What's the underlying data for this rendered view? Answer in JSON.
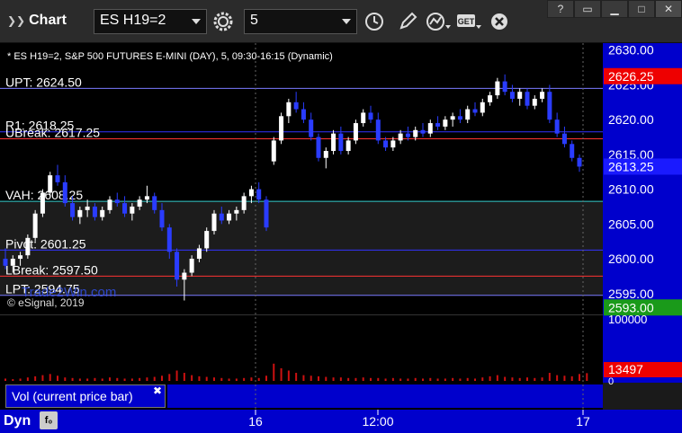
{
  "window": {
    "title": "Chart"
  },
  "toolbar": {
    "symbol": "ES H19=2",
    "interval": "5",
    "tool_icons": [
      "gear-icon",
      "clock-icon",
      "pencil-icon",
      "study-icon",
      "get-icon",
      "close-icon"
    ]
  },
  "chart": {
    "header": "* ES H19=2, S&P 500 FUTURES E-MINI (DAY), 5, 09:30-16:15 (Dynamic)",
    "copyright": "© eSignal, 2019",
    "price_axis_ticks": [
      "2630.00",
      "2625.00",
      "2620.00",
      "2615.00",
      "2610.00",
      "2605.00",
      "2600.00",
      "2595.00"
    ],
    "badges": {
      "upper": "2626.25",
      "last": "2613.25",
      "lower": "2593.00"
    },
    "levels": [
      {
        "label": "UPT: 2624.50",
        "price": 2624.5,
        "color": "#7a7aff"
      },
      {
        "label": "R1: 2618.25",
        "price": 2618.25,
        "color": "#3333ff"
      },
      {
        "label": "UBreak: 2617.25",
        "price": 2617.25,
        "color": "#ff3333"
      },
      {
        "label": "VAH: 2608.25",
        "price": 2608.25,
        "color": "#33cccc"
      },
      {
        "label": "Pivot: 2601.25",
        "price": 2601.25,
        "color": "#3333ff"
      },
      {
        "label": "LBreak: 2597.50",
        "price": 2597.5,
        "color": "#ff3333"
      },
      {
        "label": "LPT: 2594.75",
        "price": 2594.75,
        "color": "#7a7aff"
      }
    ],
    "watermark": "Trade2Win.com"
  },
  "volume": {
    "legend": "Vol (current price bar)",
    "axis_ticks": [
      "100000",
      "0"
    ],
    "badge": "13497"
  },
  "time_axis": {
    "label": "Dyn",
    "ticks": [
      "16",
      "12:00",
      "17"
    ]
  },
  "chart_data": {
    "type": "candlestick",
    "ylim": [
      2592,
      2631
    ],
    "bars": [
      [
        2600.0,
        2601.5,
        2598.5,
        2599.0
      ],
      [
        2599.0,
        2600.5,
        2598.0,
        2600.0
      ],
      [
        2600.0,
        2601.0,
        2599.0,
        2600.5
      ],
      [
        2600.5,
        2603.5,
        2600.0,
        2603.0
      ],
      [
        2603.0,
        2607.0,
        2602.5,
        2606.5
      ],
      [
        2606.5,
        2610.0,
        2606.0,
        2609.5
      ],
      [
        2609.5,
        2612.5,
        2609.0,
        2612.0
      ],
      [
        2612.0,
        2613.5,
        2610.5,
        2611.0
      ],
      [
        2611.0,
        2612.0,
        2607.5,
        2608.0
      ],
      [
        2608.0,
        2609.0,
        2605.5,
        2606.0
      ],
      [
        2606.0,
        2607.5,
        2605.0,
        2607.0
      ],
      [
        2607.0,
        2608.5,
        2606.0,
        2607.5
      ],
      [
        2607.5,
        2608.0,
        2605.5,
        2606.0
      ],
      [
        2606.0,
        2607.5,
        2605.5,
        2607.0
      ],
      [
        2607.0,
        2609.0,
        2606.5,
        2608.5
      ],
      [
        2608.5,
        2609.5,
        2607.5,
        2608.0
      ],
      [
        2608.0,
        2609.0,
        2606.0,
        2606.5
      ],
      [
        2606.5,
        2608.0,
        2605.5,
        2607.5
      ],
      [
        2607.5,
        2609.0,
        2607.0,
        2608.5
      ],
      [
        2608.5,
        2610.5,
        2608.0,
        2609.0
      ],
      [
        2609.0,
        2609.5,
        2606.5,
        2607.0
      ],
      [
        2607.0,
        2608.0,
        2604.0,
        2604.5
      ],
      [
        2604.5,
        2605.0,
        2600.0,
        2601.0
      ],
      [
        2601.0,
        2601.5,
        2596.0,
        2597.0
      ],
      [
        2597.0,
        2598.5,
        2594.0,
        2598.0
      ],
      [
        2598.0,
        2600.5,
        2597.5,
        2600.0
      ],
      [
        2600.0,
        2602.0,
        2599.5,
        2601.5
      ],
      [
        2601.5,
        2604.5,
        2601.0,
        2604.0
      ],
      [
        2604.0,
        2607.0,
        2603.5,
        2606.5
      ],
      [
        2606.5,
        2607.5,
        2605.0,
        2605.5
      ],
      [
        2605.5,
        2607.0,
        2605.0,
        2606.5
      ],
      [
        2606.5,
        2607.5,
        2605.5,
        2607.0
      ],
      [
        2607.0,
        2609.5,
        2606.5,
        2609.0
      ],
      [
        2609.0,
        2610.5,
        2608.0,
        2610.0
      ],
      [
        2610.0,
        2611.0,
        2608.0,
        2608.5
      ],
      [
        2608.5,
        2609.0,
        2604.0,
        2604.5
      ],
      [
        2614.0,
        2617.5,
        2613.5,
        2617.0
      ],
      [
        2617.0,
        2621.0,
        2616.5,
        2620.5
      ],
      [
        2620.5,
        2623.0,
        2619.5,
        2622.5
      ],
      [
        2622.5,
        2624.0,
        2621.0,
        2621.5
      ],
      [
        2621.5,
        2622.5,
        2619.5,
        2620.0
      ],
      [
        2620.0,
        2621.0,
        2617.0,
        2617.5
      ],
      [
        2617.5,
        2618.0,
        2614.0,
        2614.5
      ],
      [
        2614.5,
        2616.0,
        2613.0,
        2615.5
      ],
      [
        2615.5,
        2618.5,
        2615.0,
        2618.0
      ],
      [
        2618.0,
        2619.0,
        2615.0,
        2615.5
      ],
      [
        2615.5,
        2617.5,
        2615.0,
        2617.0
      ],
      [
        2617.0,
        2620.0,
        2616.5,
        2619.5
      ],
      [
        2619.5,
        2621.5,
        2619.0,
        2621.0
      ],
      [
        2621.0,
        2622.0,
        2619.5,
        2620.0
      ],
      [
        2620.0,
        2621.0,
        2616.5,
        2617.0
      ],
      [
        2617.0,
        2617.5,
        2615.5,
        2616.0
      ],
      [
        2616.0,
        2617.5,
        2615.5,
        2617.0
      ],
      [
        2617.0,
        2618.5,
        2616.5,
        2618.0
      ],
      [
        2618.0,
        2619.0,
        2617.0,
        2617.5
      ],
      [
        2617.5,
        2619.0,
        2617.0,
        2618.5
      ],
      [
        2618.5,
        2619.5,
        2617.5,
        2618.0
      ],
      [
        2618.0,
        2620.0,
        2617.5,
        2619.5
      ],
      [
        2619.5,
        2620.5,
        2618.5,
        2619.0
      ],
      [
        2619.0,
        2620.5,
        2618.5,
        2620.0
      ],
      [
        2620.0,
        2621.0,
        2619.0,
        2620.5
      ],
      [
        2620.5,
        2621.5,
        2619.5,
        2620.0
      ],
      [
        2620.0,
        2622.0,
        2619.5,
        2621.5
      ],
      [
        2621.5,
        2622.5,
        2620.5,
        2621.0
      ],
      [
        2621.0,
        2623.0,
        2620.5,
        2622.5
      ],
      [
        2622.5,
        2624.0,
        2622.0,
        2623.5
      ],
      [
        2623.5,
        2626.0,
        2623.0,
        2625.5
      ],
      [
        2625.5,
        2626.5,
        2623.5,
        2624.0
      ],
      [
        2624.0,
        2625.0,
        2622.5,
        2623.0
      ],
      [
        2623.0,
        2624.5,
        2622.0,
        2624.0
      ],
      [
        2624.0,
        2624.5,
        2621.5,
        2622.0
      ],
      [
        2622.0,
        2623.5,
        2621.5,
        2623.0
      ],
      [
        2623.0,
        2624.5,
        2622.5,
        2624.0
      ],
      [
        2624.0,
        2625.0,
        2619.5,
        2620.0
      ],
      [
        2620.0,
        2621.0,
        2617.5,
        2618.0
      ],
      [
        2618.0,
        2619.0,
        2616.0,
        2616.5
      ],
      [
        2616.5,
        2617.0,
        2614.0,
        2614.5
      ],
      [
        2614.5,
        2615.0,
        2612.5,
        2613.25
      ]
    ],
    "volume": [
      4,
      3,
      4,
      6,
      8,
      10,
      12,
      9,
      6,
      5,
      4,
      4,
      5,
      4,
      6,
      5,
      4,
      4,
      5,
      6,
      7,
      9,
      12,
      18,
      14,
      10,
      8,
      7,
      6,
      5,
      4,
      4,
      5,
      6,
      5,
      9,
      30,
      22,
      18,
      14,
      10,
      9,
      8,
      7,
      6,
      6,
      5,
      5,
      6,
      5,
      5,
      4,
      5,
      4,
      4,
      5,
      4,
      5,
      4,
      4,
      5,
      4,
      5,
      4,
      6,
      8,
      10,
      7,
      6,
      5,
      6,
      5,
      6,
      14,
      10,
      9,
      8,
      12,
      13.5
    ]
  }
}
